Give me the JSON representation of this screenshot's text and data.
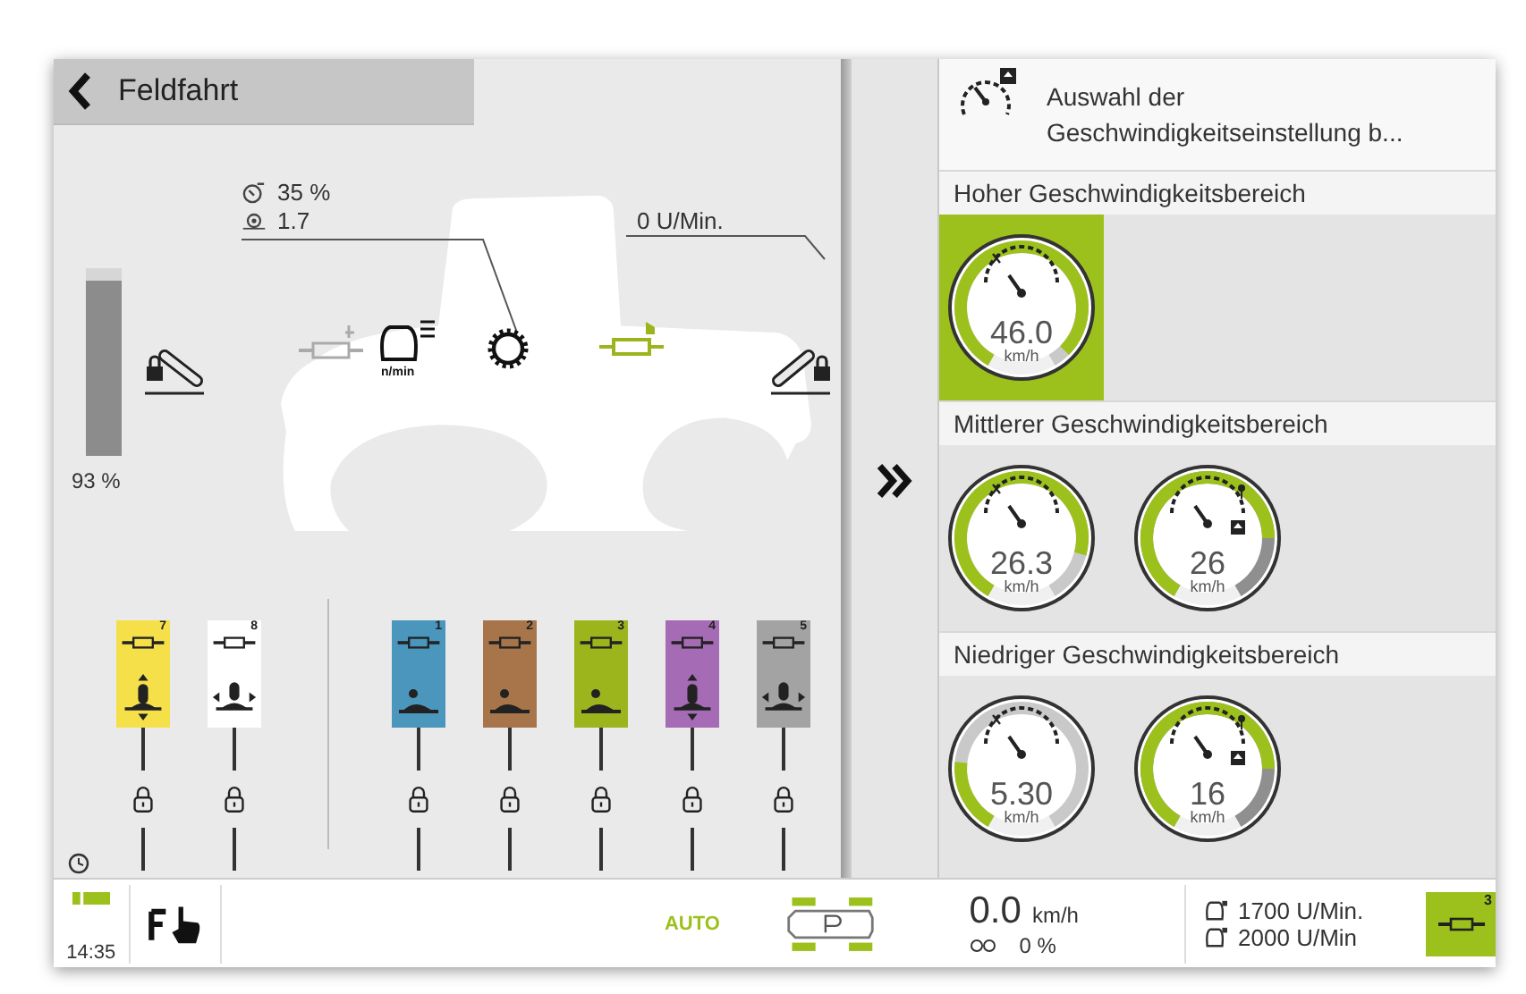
{
  "header": {
    "title": "Feldfahrt"
  },
  "tractor": {
    "throttle": "35 %",
    "ratio": "1.7",
    "pto_speed": "0 U/Min.",
    "engine_unit": "n/min",
    "fill_level": {
      "level": 0.93,
      "reading": "93 %"
    }
  },
  "valve_groups": [
    {
      "valves": [
        {
          "number": "7",
          "color": "#f5e04a",
          "kind": "vertical"
        },
        {
          "number": "8",
          "color": "#ffffff",
          "kind": "horizontal"
        }
      ]
    },
    {
      "valves": [
        {
          "number": "1",
          "color": "#4a96bd",
          "kind": "lever"
        },
        {
          "number": "2",
          "color": "#a8754b",
          "kind": "lever"
        },
        {
          "number": "3",
          "color": "#9db51c",
          "kind": "lever"
        },
        {
          "number": "4",
          "color": "#a56bb4",
          "kind": "vertical"
        },
        {
          "number": "5",
          "color": "#a3a3a3",
          "kind": "horizontal"
        }
      ]
    }
  ],
  "speed_panel": {
    "title": "Auswahl der Geschwindigkeitseinstellung b...",
    "ranges": [
      {
        "title": "Hoher Geschwindigkeitsbereich",
        "gauges": [
          {
            "kind": "actual",
            "value": "46.0",
            "unit": "km/h",
            "level": 0.95,
            "selected": true
          }
        ]
      },
      {
        "title": "Mittlerer Geschwindigkeitsbereich",
        "gauges": [
          {
            "kind": "actual",
            "value": "26.3",
            "unit": "km/h",
            "level": 0.85,
            "selected": false
          },
          {
            "kind": "target",
            "value": "26",
            "unit": "km/h",
            "level": 0.8,
            "selected": false
          }
        ]
      },
      {
        "title": "Niedriger Geschwindigkeitsbereich",
        "gauges": [
          {
            "kind": "actual",
            "value": "5.30",
            "unit": "km/h",
            "level": 0.22,
            "selected": false
          },
          {
            "kind": "target",
            "value": "16",
            "unit": "km/h",
            "level": 0.8,
            "selected": false
          }
        ]
      }
    ]
  },
  "status_bar": {
    "time": "14:35",
    "mode": "AUTO",
    "speed": "0.0",
    "speed_unit": "km/h",
    "slip": "0 %",
    "engine_rpm": "1700 U/Min.",
    "target_rpm": "2000 U/Min",
    "active_valve": "3"
  }
}
